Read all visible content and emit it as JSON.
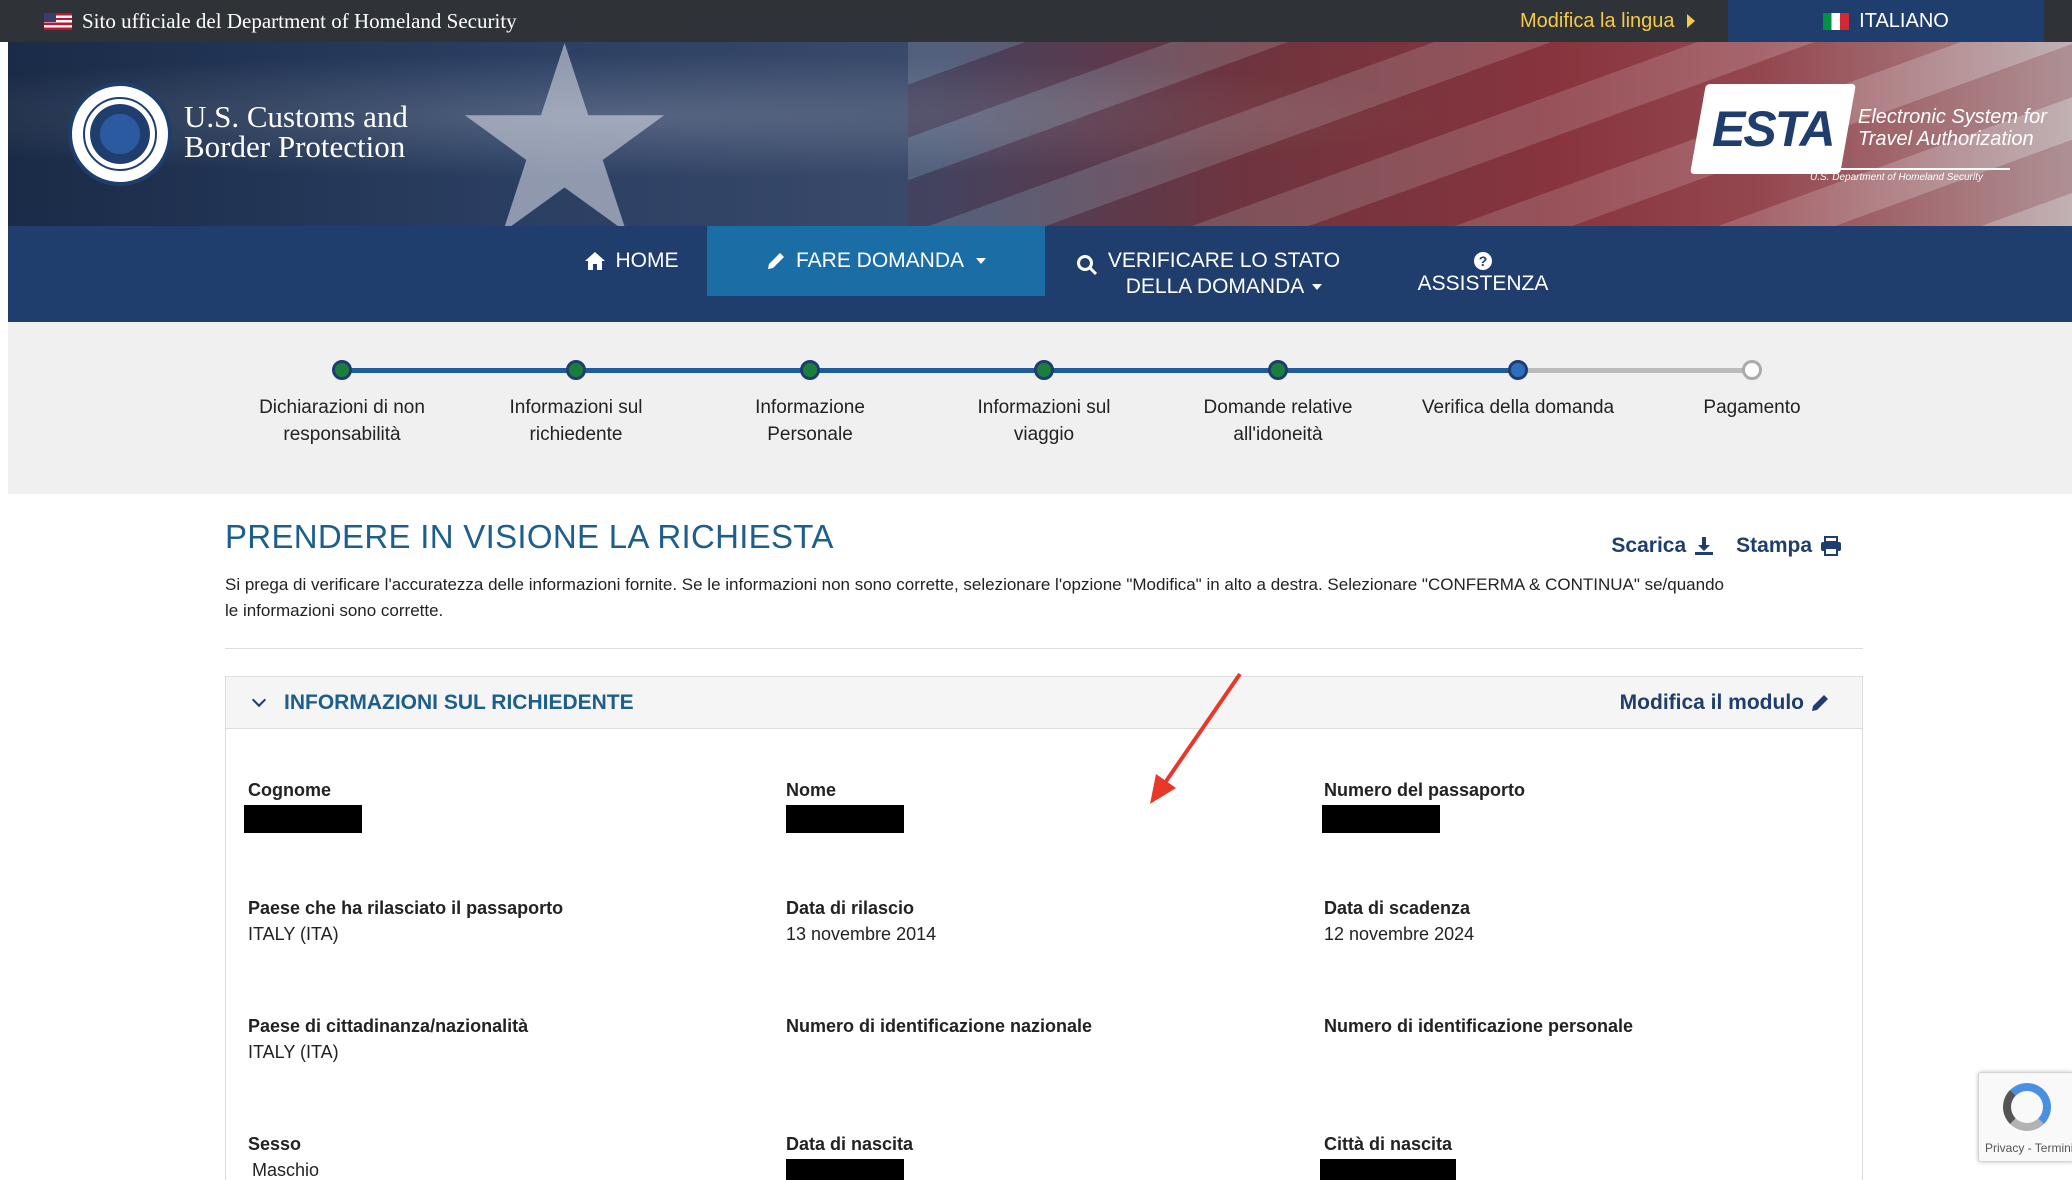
{
  "gov_bar": {
    "official_text": "Sito ufficiale del Department of Homeland Security",
    "change_language": "Modifica la lingua",
    "current_language": "ITALIANO"
  },
  "header": {
    "agency_line1": "U.S. Customs and",
    "agency_line2": "Border Protection",
    "esta_word": "ESTA",
    "esta_line1": "Electronic System for",
    "esta_line2": "Travel Authorization",
    "esta_sub": "U.S. Department of Homeland Security"
  },
  "nav": {
    "home": "HOME",
    "apply": "FARE DOMANDA",
    "check_line1": "VERIFICARE LO STATO",
    "check_line2": "DELLA DOMANDA",
    "help": "ASSISTENZA"
  },
  "progress": {
    "current_step_index": 5,
    "steps": [
      {
        "line1": "Dichiarazioni di non",
        "line2": "responsabilità",
        "status": "done"
      },
      {
        "line1": "Informazioni sul",
        "line2": "richiedente",
        "status": "done"
      },
      {
        "line1": "Informazione",
        "line2": "Personale",
        "status": "done"
      },
      {
        "line1": "Informazioni sul",
        "line2": "viaggio",
        "status": "done"
      },
      {
        "line1": "Domande relative",
        "line2": "all'idoneità",
        "status": "done"
      },
      {
        "line1": "Verifica della domanda",
        "line2": "",
        "status": "current"
      },
      {
        "line1": "Pagamento",
        "line2": "",
        "status": "todo"
      }
    ]
  },
  "main": {
    "title": "PRENDERE IN VISIONE LA RICHIESTA",
    "download": "Scarica",
    "print": "Stampa",
    "description_line1": "Si prega di verificare l'accuratezza delle informazioni fornite. Se le informazioni non sono corrette, selezionare l'opzione \"Modifica\" in alto a destra. Selezionare \"CONFERMA & CONTINUA\" se/quando",
    "description_line2": "le informazioni sono corrette."
  },
  "panel": {
    "title": "INFORMAZIONI SUL RICHIEDENTE",
    "edit": "Modifica il modulo",
    "fields": {
      "surname": {
        "label": "Cognome",
        "value": ""
      },
      "name": {
        "label": "Nome",
        "value": ""
      },
      "passport_number": {
        "label": "Numero del passaporto",
        "value": ""
      },
      "issuing_country": {
        "label": "Paese che ha rilasciato il passaporto",
        "value": "ITALY (ITA)"
      },
      "issue_date": {
        "label": "Data di rilascio",
        "value": "13 novembre 2014"
      },
      "expiry_date": {
        "label": "Data di scadenza",
        "value": "12 novembre 2024"
      },
      "citizenship": {
        "label": "Paese di cittadinanza/nazionalità",
        "value": "ITALY (ITA)"
      },
      "national_id": {
        "label": "Numero di identificazione nazionale",
        "value": ""
      },
      "personal_id": {
        "label": "Numero di identificazione personale",
        "value": ""
      },
      "sex": {
        "label": "Sesso",
        "value": "Maschio"
      },
      "birth_date": {
        "label": "Data di nascita",
        "value": ""
      },
      "birth_city": {
        "label": "Città di nascita",
        "value": ""
      }
    }
  },
  "recaptcha": {
    "text": "Privacy - Termini"
  },
  "colors": {
    "nav_bg": "#1f3e6e",
    "nav_active": "#1b6ea5",
    "title_blue": "#1d5f8c",
    "step_done": "#1a7f3c",
    "step_current": "#2c6fbf",
    "arrow_red": "#e8382a",
    "language_link": "#f7c948"
  }
}
